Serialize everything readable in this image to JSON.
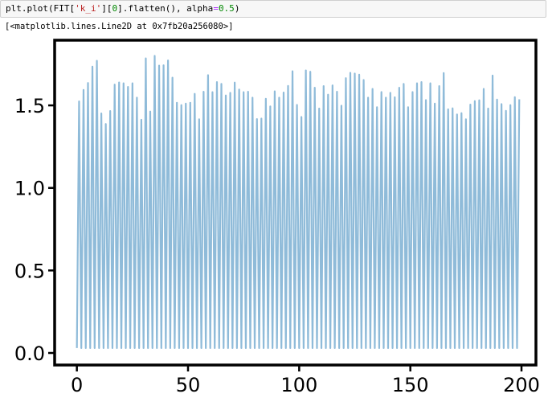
{
  "cell": {
    "code_parts": [
      "plt.plot(FIT[",
      "'k_i'",
      "][",
      "0",
      "].flatten(), alpha",
      "=",
      "0.5",
      ")"
    ],
    "output": "[<matplotlib.lines.Line2D at 0x7fb20a256080>]"
  },
  "colors": {
    "line": "#1f77b4",
    "alpha": 0.5
  },
  "chart_data": {
    "type": "line",
    "title": "",
    "xlabel": "",
    "ylabel": "",
    "xlim": [
      -10,
      206.5
    ],
    "ylim": [
      -0.073,
      1.895
    ],
    "xticks": [
      0,
      50,
      100,
      150,
      200
    ],
    "xtick_labels": [
      "0",
      "50",
      "100",
      "150",
      "200"
    ],
    "yticks": [
      0.0,
      0.5,
      1.0,
      1.5
    ],
    "ytick_labels": [
      "0.0",
      "0.5",
      "1.0",
      "1.5"
    ],
    "grid": false,
    "series": [
      {
        "name": "k_i",
        "low_value": 0.03,
        "note_pattern": "even indices low, odd indices peaks",
        "peaks": [
          1.524,
          1.594,
          1.636,
          1.735,
          1.77,
          1.451,
          1.387,
          1.466,
          1.626,
          1.639,
          1.634,
          1.612,
          1.634,
          1.547,
          1.413,
          1.785,
          1.463,
          1.8,
          1.741,
          1.743,
          1.772,
          1.668,
          1.516,
          1.502,
          1.511,
          1.516,
          1.57,
          1.416,
          1.583,
          1.683,
          1.58,
          1.641,
          1.63,
          1.56,
          1.576,
          1.638,
          1.596,
          1.58,
          1.583,
          1.547,
          1.417,
          1.42,
          1.54,
          1.494,
          1.585,
          1.547,
          1.578,
          1.618,
          1.707,
          1.503,
          1.43,
          1.712,
          1.704,
          1.607,
          1.481,
          1.617,
          1.565,
          1.621,
          1.583,
          1.498,
          1.665,
          1.697,
          1.693,
          1.686,
          1.654,
          1.547,
          1.6,
          1.489,
          1.581,
          1.547,
          1.576,
          1.549,
          1.607,
          1.63,
          1.489,
          1.581,
          1.634,
          1.641,
          1.532,
          1.634,
          1.511,
          1.617,
          1.696,
          1.476,
          1.482,
          1.445,
          1.453,
          1.416,
          1.505,
          1.526,
          1.531,
          1.6,
          1.481,
          1.681,
          1.535,
          1.508,
          1.467,
          1.502,
          1.55,
          1.537
        ]
      }
    ]
  }
}
